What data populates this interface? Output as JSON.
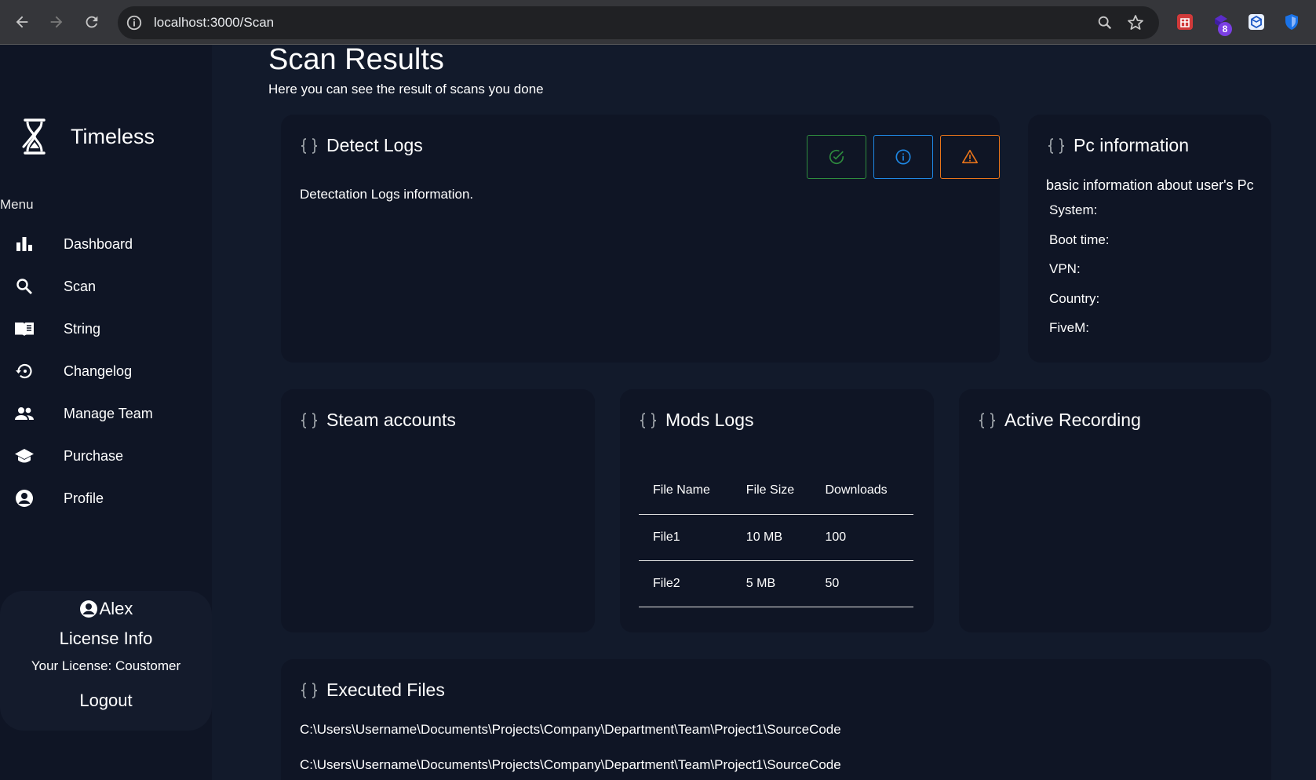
{
  "browser": {
    "url": "localhost:3000/Scan",
    "extension_badge": "8"
  },
  "sidebar": {
    "brand": "Timeless",
    "menu_title": "Menu",
    "items": [
      {
        "label": "Dashboard",
        "icon": "bar-chart-icon"
      },
      {
        "label": "Scan",
        "icon": "search-icon"
      },
      {
        "label": "String",
        "icon": "book-icon"
      },
      {
        "label": "Changelog",
        "icon": "history-icon"
      },
      {
        "label": "Manage Team",
        "icon": "people-icon"
      },
      {
        "label": "Purchase",
        "icon": "graduation-cap-icon"
      },
      {
        "label": "Profile",
        "icon": "user-circle-icon"
      }
    ],
    "user": {
      "name": "Alex",
      "license_title": "License Info",
      "license_text": "Your License: Coustomer",
      "logout": "Logout"
    }
  },
  "page": {
    "title": "Scan Results",
    "subtitle": "Here you can see the result of scans you done"
  },
  "detect_logs": {
    "title": "Detect Logs",
    "description": "Detectation Logs information.",
    "status_colors": {
      "success": "#2e8b3e",
      "info": "#1e88e5",
      "warning": "#e8741a"
    }
  },
  "pc_info": {
    "title": "Pc information",
    "description": "basic information about user's Pc",
    "rows": [
      "System:",
      "Boot time:",
      "VPN:",
      "Country:",
      "FiveM:"
    ]
  },
  "steam": {
    "title": "Steam accounts"
  },
  "mods": {
    "title": "Mods Logs",
    "columns": [
      "File Name",
      "File Size",
      "Downloads"
    ],
    "rows": [
      [
        "File1",
        "10 MB",
        "100"
      ],
      [
        "File2",
        "5 MB",
        "50"
      ]
    ]
  },
  "recording": {
    "title": "Active Recording"
  },
  "executed": {
    "title": "Executed Files",
    "paths": [
      "C:\\Users\\Username\\Documents\\Projects\\Company\\Department\\Team\\Project1\\SourceCode",
      "C:\\Users\\Username\\Documents\\Projects\\Company\\Department\\Team\\Project1\\SourceCode"
    ]
  }
}
